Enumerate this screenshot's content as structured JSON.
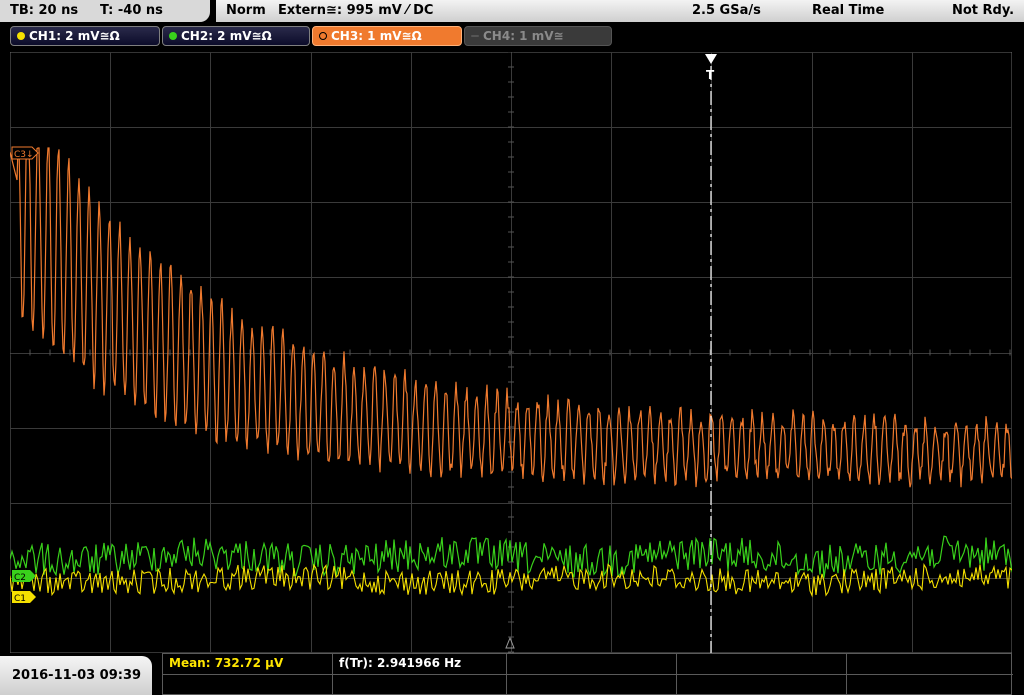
{
  "status": {
    "timebase": "TB: 20 ns",
    "trigger_offset": "T: -40 ns",
    "mode": "Norm",
    "trigger_source": "Extern≅: 995 mV ⁄ DC",
    "sample_rate": "2.5 GSa/s",
    "acq_mode": "Real Time",
    "state": "Not Rdy."
  },
  "channels": [
    {
      "label": "CH1: 2 mV≅Ω",
      "color": "#f5e000"
    },
    {
      "label": "CH2: 2 mV≅Ω",
      "color": "#39d11b"
    },
    {
      "label": "CH3: 1 mV≅Ω",
      "color": "#f07a2e"
    },
    {
      "label": "CH4: 1 mV≅",
      "color": "#7a7a7a"
    }
  ],
  "markers": {
    "ch3": "C3↓",
    "ch2": "C2",
    "ch1": "C1",
    "trigger": "T"
  },
  "footer": {
    "datetime": "2016-11-03 09:39",
    "mean_label": "Mean: 732.72 µV",
    "freq_label": "f(Tr): 2.941966 Hz"
  },
  "colors": {
    "ch1": "#f5e000",
    "ch2": "#39d11b",
    "ch3": "#f07a2e",
    "grid": "#3a3a3a",
    "trigger_line": "#ffffff"
  }
}
